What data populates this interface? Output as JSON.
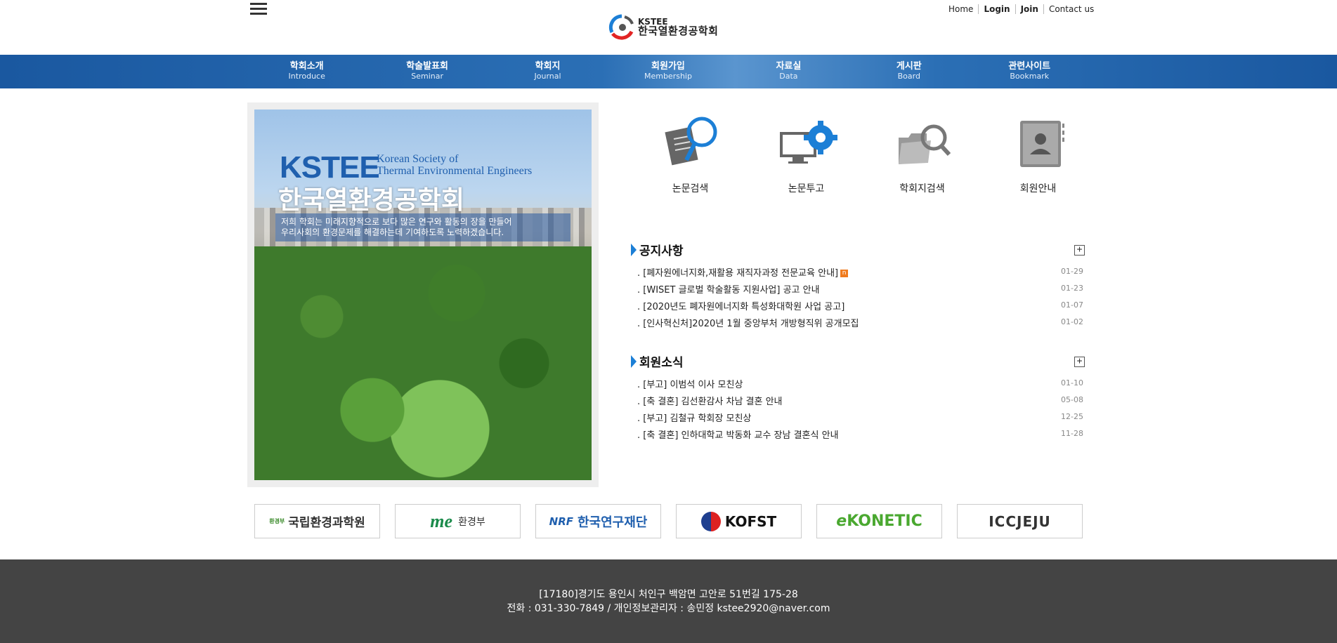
{
  "header": {
    "logo_en": "KSTEE",
    "logo_ko": "한국열환경공학회",
    "links": [
      "Home",
      "Login",
      "Join",
      "Contact us"
    ]
  },
  "nav": [
    {
      "ko": "학회소개",
      "en": "Introduce"
    },
    {
      "ko": "학술발표회",
      "en": "Seminar"
    },
    {
      "ko": "학회지",
      "en": "Journal"
    },
    {
      "ko": "회원가입",
      "en": "Membership"
    },
    {
      "ko": "자료실",
      "en": "Data"
    },
    {
      "ko": "게시판",
      "en": "Board"
    },
    {
      "ko": "관련사이트",
      "en": "Bookmark"
    }
  ],
  "banner": {
    "title_en": "KSTEE",
    "subtitle_en_1": "Korean Society of",
    "subtitle_en_2": "Thermal Environmental Engineers",
    "title_ko": "한국열환경공학회",
    "desc_1": "저희 학회는 미래지향적으로 보다 많은 연구와 활동의 장을 만들어",
    "desc_2": "우리사회의 환경문제를 해결하는데 기여하도록 노력하겠습니다."
  },
  "quick_links": [
    {
      "label": "논문검색",
      "icon": "paper-search-icon"
    },
    {
      "label": "논문투고",
      "icon": "submit-gear-icon"
    },
    {
      "label": "학회지검색",
      "icon": "folder-search-icon"
    },
    {
      "label": "회원안내",
      "icon": "member-book-icon"
    }
  ],
  "notice": {
    "title": "공지사항",
    "more": "+",
    "items": [
      {
        "title": ". [폐자원에너지화,재활용 재직자과정 전문교육 안내]",
        "date": "01-29",
        "new": "n"
      },
      {
        "title": ". [WISET 글로벌 학술활동 지원사업] 공고 안내",
        "date": "01-23"
      },
      {
        "title": ". [2020년도 폐자원에너지화 특성화대학원 사업 공고]",
        "date": "01-07"
      },
      {
        "title": ". [인사혁신처]2020년 1월 중앙부처 개방형직위 공개모집",
        "date": "01-02"
      }
    ]
  },
  "member_news": {
    "title": "회원소식",
    "more": "+",
    "items": [
      {
        "title": ". [부고] 이범석 이사 모친상",
        "date": "01-10"
      },
      {
        "title": ". [축 결혼] 김선환감사 차남 결혼 안내",
        "date": "05-08"
      },
      {
        "title": ". [부고] 김철규 학회장 모친상",
        "date": "12-25"
      },
      {
        "title": ". [축 결혼] 인하대학교 박동화 교수 장남 결혼식 안내",
        "date": "11-28"
      }
    ]
  },
  "partners": [
    {
      "mark": "환경부",
      "name": "국립환경과학원"
    },
    {
      "mark": "me",
      "name": "환경부"
    },
    {
      "mark": "NRF",
      "name": "한국연구재단"
    },
    {
      "mark": "",
      "name": "KOFST"
    },
    {
      "mark": "e",
      "name": "KONETIC"
    },
    {
      "mark": "",
      "name": "ICCJEJU"
    }
  ],
  "footer": {
    "address": "[17180]경기도 용인시 처인구 백암면 고안로 51번길 175-28",
    "contact": "전화 : 031-330-7849  /  개인정보관리자 : 송민정 kstee2920@naver.com"
  },
  "colors": {
    "nav_blue": "#1a58a0",
    "accent_blue": "#1c7fd6",
    "footer_bg": "#444444",
    "new_badge": "#f07b1d"
  }
}
